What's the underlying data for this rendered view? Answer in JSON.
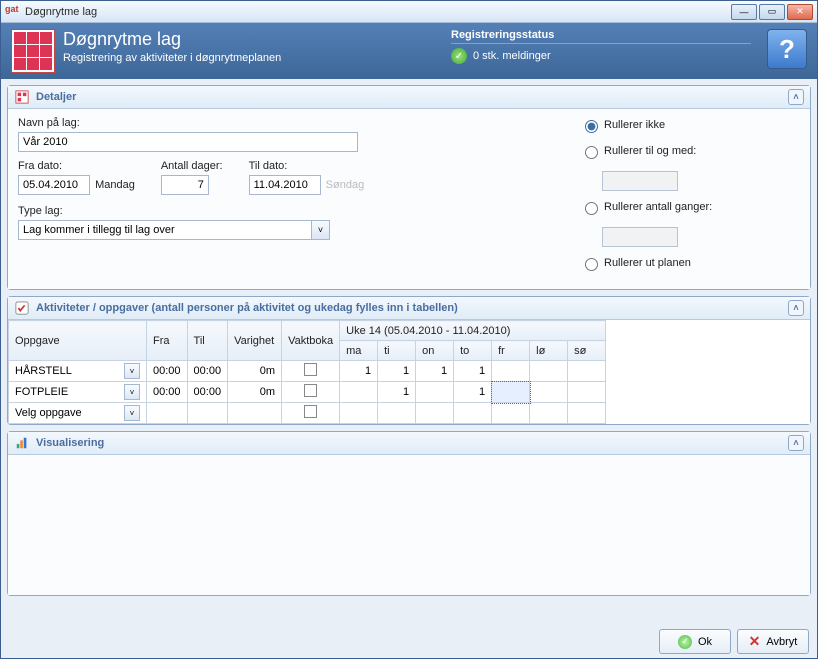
{
  "window": {
    "title": "Døgnrytme lag"
  },
  "header": {
    "title": "Døgnrytme lag",
    "subtitle": "Registrering av aktiviteter i døgnrytmeplanen",
    "status_title": "Registreringsstatus",
    "status_msg": "0 stk. meldinger"
  },
  "panels": {
    "detaljer": "Detaljer",
    "aktiviteter": "Aktiviteter / oppgaver (antall personer på aktivitet og ukedag fylles inn i tabellen)",
    "visualisering": "Visualisering"
  },
  "detaljer": {
    "navn_label": "Navn på lag:",
    "navn_value": "Vår 2010",
    "fra_label": "Fra dato:",
    "fra_value": "05.04.2010",
    "fra_day": "Mandag",
    "antall_label": "Antall dager:",
    "antall_value": "7",
    "til_label": "Til dato:",
    "til_value": "11.04.2010",
    "til_day": "Søndag",
    "type_label": "Type lag:",
    "type_value": "Lag kommer i tillegg til lag over",
    "r1": "Rullerer ikke",
    "r2": "Rullerer til og med:",
    "r3": "Rullerer antall ganger:",
    "r4": "Rullerer ut planen"
  },
  "grid": {
    "cols": {
      "oppgave": "Oppgave",
      "fra": "Fra",
      "til": "Til",
      "varighet": "Varighet",
      "vaktboka": "Vaktboka"
    },
    "week_header": "Uke 14 (05.04.2010 - 11.04.2010)",
    "days": [
      "ma",
      "ti",
      "on",
      "to",
      "fr",
      "lø",
      "sø"
    ],
    "rows": [
      {
        "name": "HÅRSTELL",
        "fra": "00:00",
        "til": "00:00",
        "var": "0m",
        "vals": [
          "1",
          "1",
          "1",
          "1",
          "",
          "",
          ""
        ]
      },
      {
        "name": "FOTPLEIE",
        "fra": "00:00",
        "til": "00:00",
        "var": "0m",
        "vals": [
          "",
          "1",
          "",
          "1",
          "",
          "",
          ""
        ]
      }
    ],
    "new_row": "Velg oppgave"
  },
  "buttons": {
    "ok": "Ok",
    "cancel": "Avbryt"
  }
}
